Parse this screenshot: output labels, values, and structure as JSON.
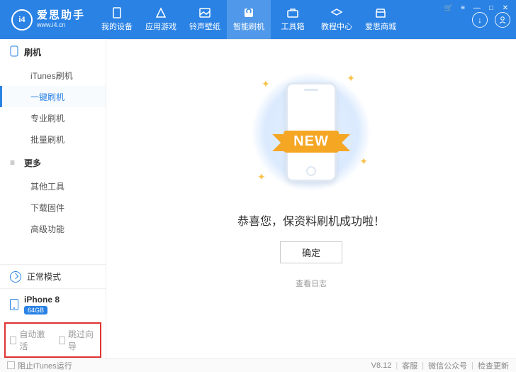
{
  "app": {
    "name_cn": "爱思助手",
    "url": "www.i4.cn",
    "logo_text": "i4"
  },
  "nav": [
    {
      "label": "我的设备"
    },
    {
      "label": "应用游戏"
    },
    {
      "label": "铃声壁纸"
    },
    {
      "label": "智能刷机"
    },
    {
      "label": "工具箱"
    },
    {
      "label": "教程中心"
    },
    {
      "label": "爱思商城"
    }
  ],
  "sidebar": {
    "section_flash": "刷机",
    "flash_items": [
      {
        "label": "iTunes刷机"
      },
      {
        "label": "一键刷机"
      },
      {
        "label": "专业刷机"
      },
      {
        "label": "批量刷机"
      }
    ],
    "section_more": "更多",
    "more_items": [
      {
        "label": "其他工具"
      },
      {
        "label": "下载固件"
      },
      {
        "label": "高级功能"
      }
    ],
    "mode": "正常模式",
    "device": {
      "name": "iPhone 8",
      "storage": "64GB"
    },
    "options": {
      "auto_activate": "自动激活",
      "skip_guide": "跳过向导"
    }
  },
  "main": {
    "ribbon": "NEW",
    "message": "恭喜您，保资料刷机成功啦！",
    "ok": "确定",
    "view_log": "查看日志"
  },
  "footer": {
    "block_itunes": "阻止iTunes运行",
    "version": "V8.12",
    "support": "客服",
    "wechat": "微信公众号",
    "update": "检查更新"
  }
}
